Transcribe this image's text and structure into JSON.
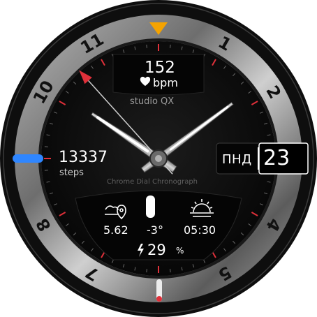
{
  "watch_face": {
    "brand": "studio QX",
    "subbrand": "Chrome Dial Chronograph",
    "bezel_numerals": [
      "1",
      "2",
      "4",
      "5",
      "7",
      "8",
      "10",
      "11"
    ],
    "heart_rate": {
      "value": "152",
      "unit_label": "bpm",
      "icon": "heart-icon"
    },
    "steps": {
      "value": "13337",
      "label": "steps"
    },
    "weather": {
      "location_value": "5.62",
      "temperature": "-3°",
      "sunrise_time": "05:30",
      "icons": [
        "location-weather-icon",
        "sunrise-icon"
      ]
    },
    "battery": {
      "value": "29",
      "unit": "%",
      "icon": "lightning-icon"
    },
    "date": {
      "day": "ПНД",
      "number": "23"
    },
    "time": {
      "hours": 10,
      "minutes": 8,
      "seconds": 53
    },
    "colors": {
      "accent_red": "#e0303a",
      "marker_orange": "#f5a300",
      "marker_blue": "#2f86ff",
      "dial": "#111111"
    }
  }
}
